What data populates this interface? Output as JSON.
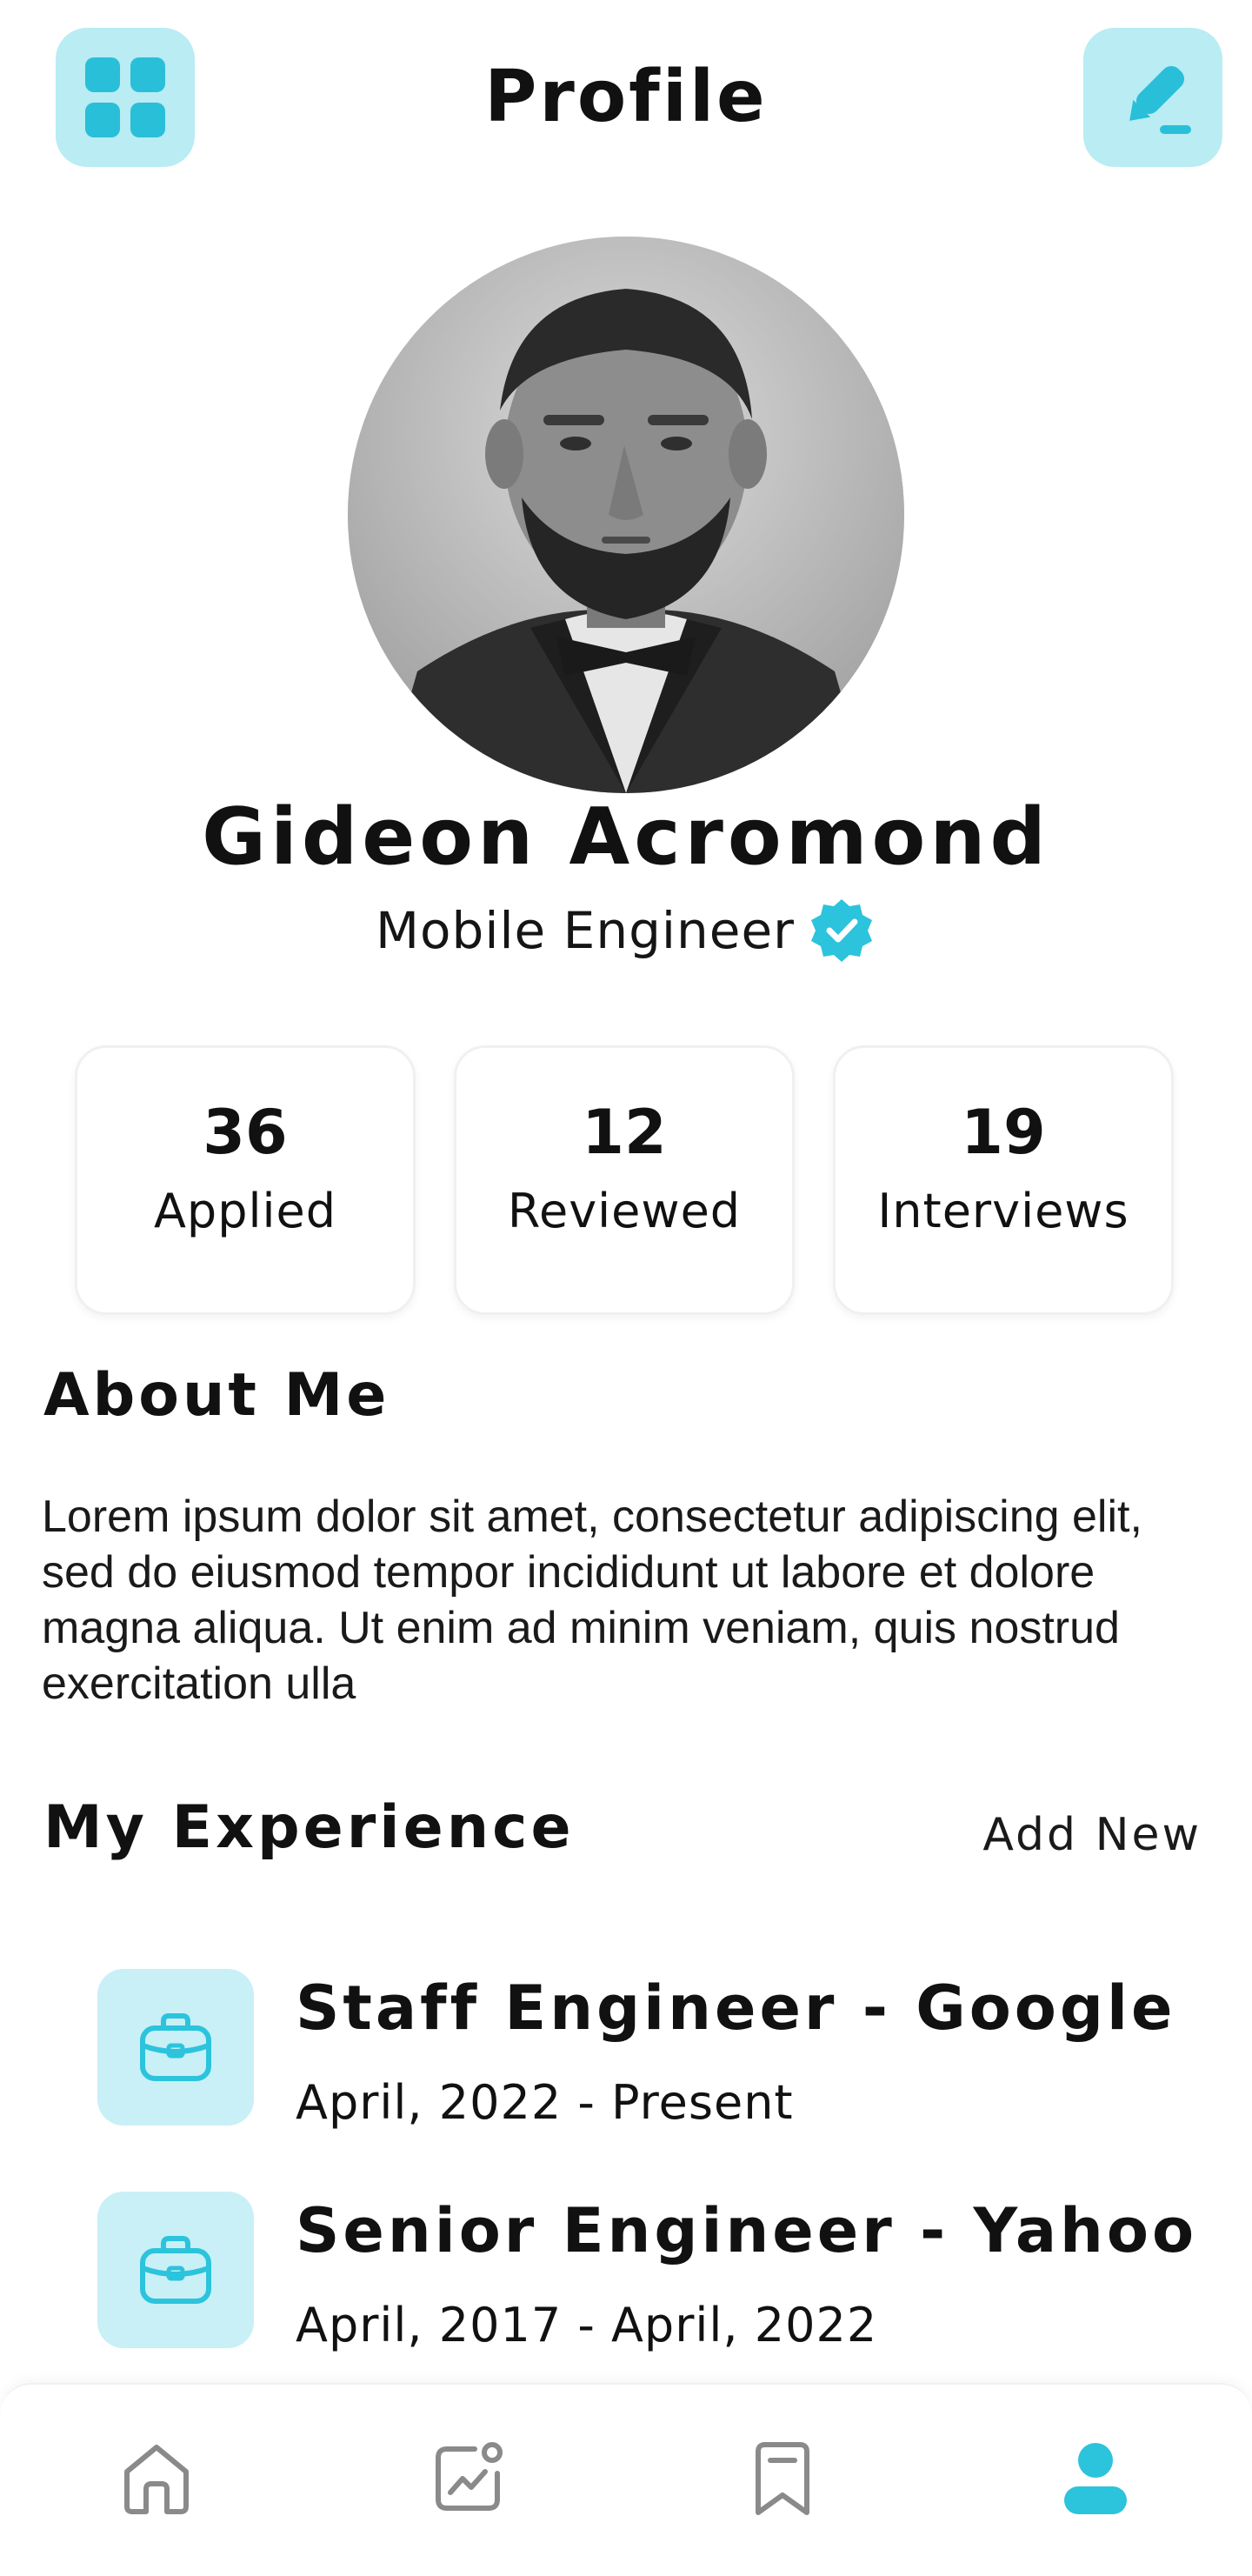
{
  "header": {
    "title": "Profile",
    "menu_icon": "grid-icon",
    "edit_icon": "edit-pencil-icon"
  },
  "profile": {
    "name": "Gideon Acromond",
    "role": "Mobile Engineer",
    "verified_icon": "verified-badge-icon"
  },
  "stats": [
    {
      "value": "36",
      "label": "Applied"
    },
    {
      "value": "12",
      "label": "Reviewed"
    },
    {
      "value": "19",
      "label": "Interviews"
    }
  ],
  "about": {
    "title": "About Me",
    "text": "Lorem ipsum dolor sit amet, consectetur adipiscing elit, sed do eiusmod tempor incididunt ut labore et dolore magna aliqua. Ut enim ad minim veniam, quis nostrud exercitation ulla"
  },
  "experience": {
    "title": "My Experience",
    "add_new_label": "Add New",
    "items": [
      {
        "title": "Staff Engineer - Google",
        "dates": "April, 2022 - Present",
        "icon": "briefcase-icon"
      },
      {
        "title": "Senior Engineer - Yahoo",
        "dates": "April, 2017 - April, 2022",
        "icon": "briefcase-icon"
      }
    ]
  },
  "bottom_nav": {
    "items": [
      {
        "icon": "home-icon",
        "active": false
      },
      {
        "icon": "chart-icon",
        "active": false
      },
      {
        "icon": "bookmark-icon",
        "active": false
      },
      {
        "icon": "user-icon",
        "active": true
      }
    ]
  },
  "colors": {
    "accent": "#2cc3dc",
    "accent_light": "#b9ecf3",
    "inactive_icon": "#8a8a8a"
  }
}
